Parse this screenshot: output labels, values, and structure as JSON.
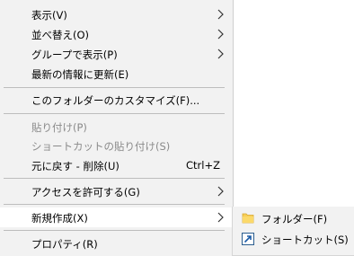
{
  "menu": {
    "items": [
      {
        "label": "表示(V)",
        "submenu": true,
        "enabled": true
      },
      {
        "label": "並べ替え(O)",
        "submenu": true,
        "enabled": true
      },
      {
        "label": "グループで表示(P)",
        "submenu": true,
        "enabled": true
      },
      {
        "label": "最新の情報に更新(E)",
        "submenu": false,
        "enabled": true
      },
      {
        "label": "このフォルダーのカスタマイズ(F)...",
        "submenu": false,
        "enabled": true
      },
      {
        "label": "貼り付け(P)",
        "submenu": false,
        "enabled": false
      },
      {
        "label": "ショートカットの貼り付け(S)",
        "submenu": false,
        "enabled": false
      },
      {
        "label": "元に戻す - 削除(U)",
        "shortcut": "Ctrl+Z",
        "enabled": true
      },
      {
        "label": "アクセスを許可する(G)",
        "submenu": true,
        "enabled": true
      },
      {
        "label": "新規作成(X)",
        "submenu": true,
        "enabled": true,
        "highlighted": true
      },
      {
        "label": "プロパティ(R)",
        "submenu": false,
        "enabled": true
      }
    ]
  },
  "submenu_new": {
    "items": [
      {
        "label": "フォルダー(F)",
        "icon": "folder-icon"
      },
      {
        "label": "ショートカット(S)",
        "icon": "shortcut-icon"
      }
    ]
  },
  "colors": {
    "menu_bg": "#f2f2f2",
    "highlight_bg": "#ffffff",
    "disabled_text": "#8a8a8a",
    "separator": "#bdbdbd"
  }
}
